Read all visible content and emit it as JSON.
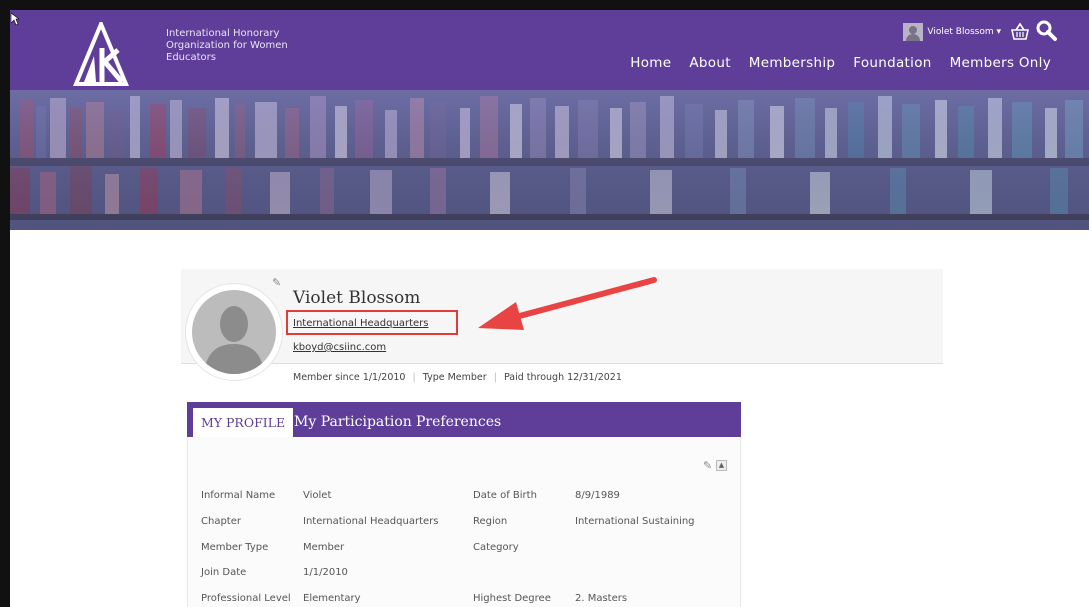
{
  "org": {
    "line1": "International Honorary",
    "line2": "Organization for Women",
    "line3": "Educators"
  },
  "user_menu": {
    "name": "Violet Blossom ▾"
  },
  "nav": [
    "Home",
    "About",
    "Membership",
    "Foundation",
    "Members Only"
  ],
  "profile": {
    "name": "Violet Blossom",
    "chapter_link": "International Headquarters",
    "email": "kboyd@csiinc.com",
    "meta": {
      "member_since_label": "Member since",
      "member_since": "1/1/2010",
      "type_label": "Type",
      "type": "Member",
      "paid_label": "Paid through",
      "paid": "12/31/2021"
    }
  },
  "tabs": [
    "MY PROFILE",
    "My Participation",
    "Preferences"
  ],
  "fields": {
    "informal_name": {
      "label": "Informal Name",
      "value": "Violet"
    },
    "dob": {
      "label": "Date of Birth",
      "value": "8/9/1989"
    },
    "chapter": {
      "label": "Chapter",
      "value": "International Headquarters"
    },
    "region": {
      "label": "Region",
      "value": "International Sustaining"
    },
    "member_type": {
      "label": "Member Type",
      "value": "Member"
    },
    "category": {
      "label": "Category",
      "value": ""
    },
    "join_date": {
      "label": "Join Date",
      "value": "1/1/2010"
    },
    "prof_level": {
      "label": "Professional Level",
      "value": "Elementary"
    },
    "degree": {
      "label": "Highest Degree",
      "value": "2. Masters"
    }
  },
  "colors": {
    "brand_purple": "#5f3e9a",
    "highlight_red": "#e23b3b"
  }
}
